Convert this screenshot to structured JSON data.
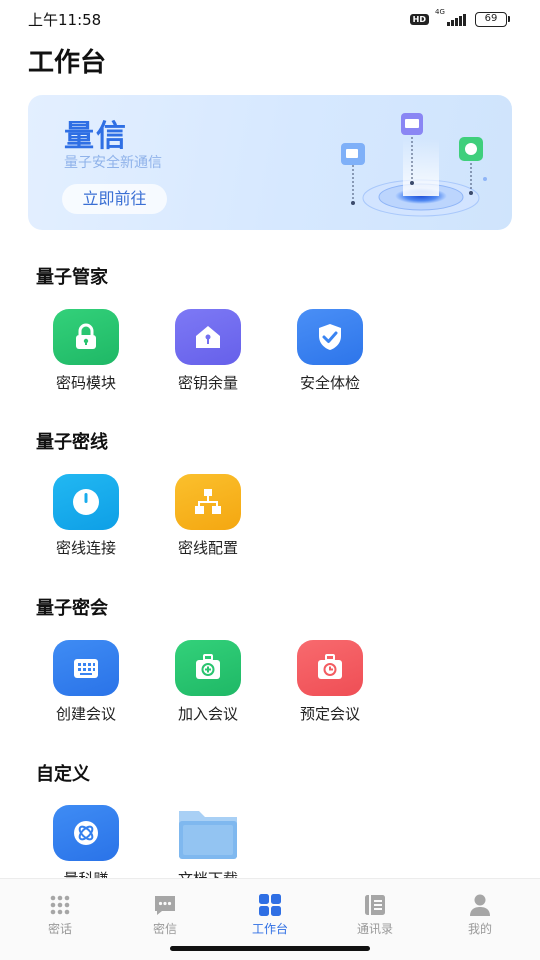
{
  "status": {
    "time": "上午11:58",
    "hd": "HD",
    "network": "4G",
    "battery": "69"
  },
  "page": {
    "title": "工作台"
  },
  "banner": {
    "title": "量信",
    "subtitle": "量子安全新通信",
    "button": "立即前往"
  },
  "sections": {
    "housekeeper": {
      "title": "量子管家",
      "items": [
        {
          "label": "密码模块",
          "icon": "lock-icon",
          "color": "#29c46f"
        },
        {
          "label": "密钥余量",
          "icon": "house-key-icon",
          "color": "#7470f0"
        },
        {
          "label": "安全体检",
          "icon": "shield-check-icon",
          "color": "#3a84f2"
        }
      ]
    },
    "secure_line": {
      "title": "量子密线",
      "items": [
        {
          "label": "密线连接",
          "icon": "power-icon",
          "color": "#18acec"
        },
        {
          "label": "密线配置",
          "icon": "network-tree-icon",
          "color": "#f8b420"
        }
      ]
    },
    "meeting": {
      "title": "量子密会",
      "items": [
        {
          "label": "创建会议",
          "icon": "keyboard-icon",
          "color": "#3a84f2"
        },
        {
          "label": "加入会议",
          "icon": "join-meeting-icon",
          "color": "#29c46f"
        },
        {
          "label": "预定会议",
          "icon": "schedule-meeting-icon",
          "color": "#f25c61"
        }
      ]
    },
    "custom": {
      "title": "自定义",
      "items": [
        {
          "label": "量科赚",
          "icon": "atom-icon",
          "color": "#3580ee"
        },
        {
          "label": "文档下载",
          "icon": "folder-icon",
          "color": "#7fb8ef"
        }
      ]
    }
  },
  "nav": {
    "items": [
      {
        "label": "密话",
        "icon": "dialpad-icon"
      },
      {
        "label": "密信",
        "icon": "message-icon"
      },
      {
        "label": "工作台",
        "icon": "workbench-grid-icon",
        "active": true
      },
      {
        "label": "通讯录",
        "icon": "contacts-book-icon"
      },
      {
        "label": "我的",
        "icon": "profile-icon"
      }
    ]
  },
  "colors": {
    "accent": "#2f6fe4",
    "nav_inactive": "#999999"
  }
}
